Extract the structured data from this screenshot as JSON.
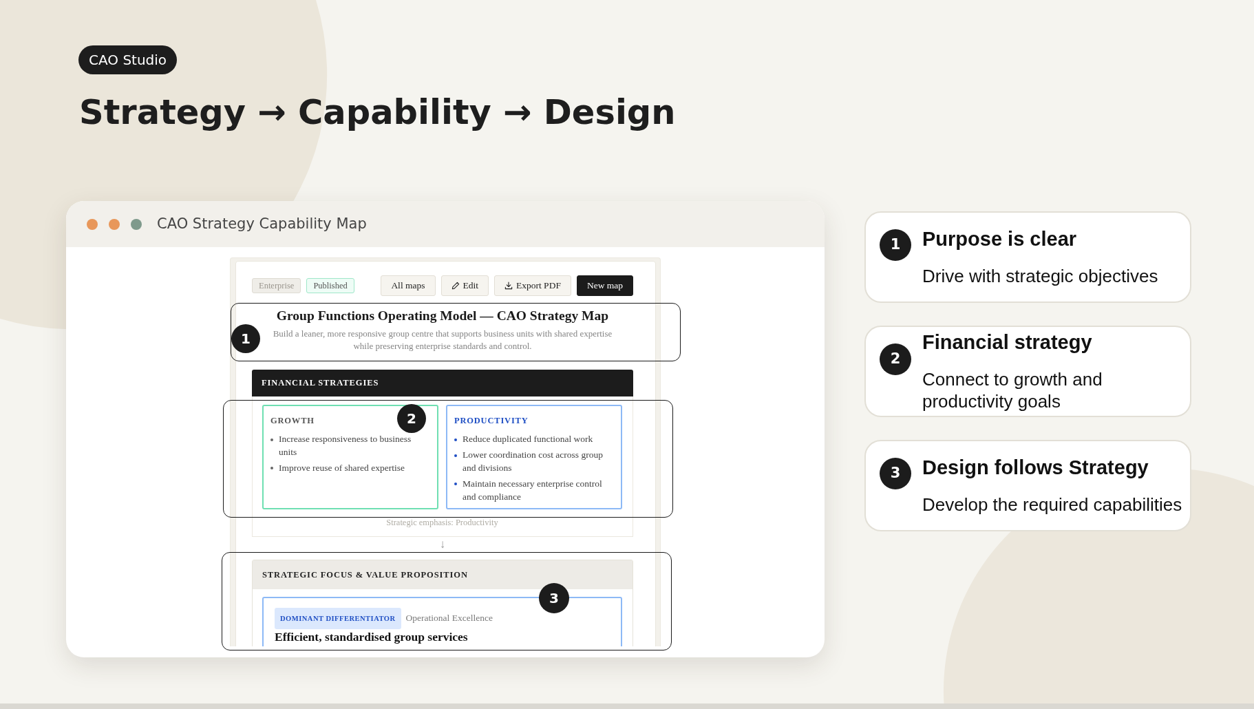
{
  "header": {
    "badge": "CAO Studio",
    "title": "Strategy → Capability → Design"
  },
  "window": {
    "title": "CAO Strategy Capability Map",
    "controls": [
      {
        "color": "#e8975a"
      },
      {
        "color": "#e8975a"
      },
      {
        "color": "#7f9a8c"
      }
    ]
  },
  "document": {
    "tags": [
      {
        "label": "Enterprise",
        "kind": "neutral"
      },
      {
        "label": "Published",
        "kind": "success"
      }
    ],
    "actions": [
      {
        "label": "All maps",
        "kind": "plain"
      },
      {
        "label": "Edit",
        "kind": "edit"
      },
      {
        "label": "Export PDF",
        "kind": "export"
      },
      {
        "label": "New map",
        "kind": "primary"
      }
    ],
    "title": "Group Functions Operating Model — CAO Strategy Map",
    "description": "Build a leaner, more responsive group centre that supports business units with shared expertise while preserving enterprise standards and control.",
    "financial": {
      "heading": "FINANCIAL STRATEGIES",
      "strategies": [
        {
          "name": "GROWTH",
          "color": "#6fdfb2",
          "emphasized": false,
          "items": [
            "Increase responsiveness to business units",
            "Improve reuse of shared expertise"
          ]
        },
        {
          "name": "PRODUCTIVITY",
          "color": "#8db9f6",
          "emphasized": true,
          "items": [
            "Reduce duplicated functional work",
            "Lower coordination cost across group and divisions",
            "Maintain necessary enterprise control and compliance"
          ]
        }
      ],
      "emphasis": "Strategic emphasis: Productivity"
    },
    "connector": "↓",
    "focus": {
      "heading": "STRATEGIC FOCUS & VALUE PROPOSITION",
      "propositions": [
        {
          "tag": "DOMINANT DIFFERENTIATOR",
          "discipline": "Operational Excellence",
          "title": "Efficient, standardised group services"
        }
      ]
    }
  },
  "annotations": [
    {
      "number": "1"
    },
    {
      "number": "2"
    },
    {
      "number": "3"
    }
  ],
  "callouts": [
    {
      "number": "1",
      "title": "Purpose is clear",
      "text": "Drive with strategic objectives"
    },
    {
      "number": "2",
      "title": "Financial strategy",
      "text": "Connect to growth and productivity goals"
    },
    {
      "number": "3",
      "title": "Design follows Strategy",
      "text": "Develop the required capabilities"
    }
  ]
}
